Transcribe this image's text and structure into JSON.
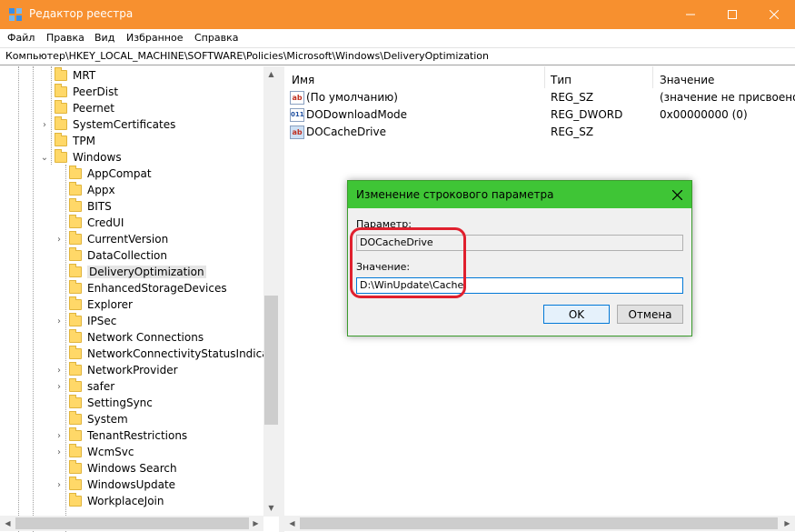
{
  "window": {
    "title": "Редактор реестра",
    "accent": "#f7902f"
  },
  "menu": [
    "Файл",
    "Правка",
    "Вид",
    "Избранное",
    "Справка"
  ],
  "address": "Компьютер\\HKEY_LOCAL_MACHINE\\SOFTWARE\\Policies\\Microsoft\\Windows\\DeliveryOptimization",
  "tree": {
    "level1": [
      {
        "label": "MRT",
        "expand": ""
      },
      {
        "label": "PeerDist",
        "expand": ""
      },
      {
        "label": "Peernet",
        "expand": ""
      },
      {
        "label": "SystemCertificates",
        "expand": "collapsed"
      },
      {
        "label": "TPM",
        "expand": ""
      },
      {
        "label": "Windows",
        "expand": "expanded"
      }
    ],
    "level2": [
      {
        "label": "AppCompat",
        "expand": ""
      },
      {
        "label": "Appx",
        "expand": ""
      },
      {
        "label": "BITS",
        "expand": ""
      },
      {
        "label": "CredUI",
        "expand": ""
      },
      {
        "label": "CurrentVersion",
        "expand": "collapsed"
      },
      {
        "label": "DataCollection",
        "expand": ""
      },
      {
        "label": "DeliveryOptimization",
        "expand": "",
        "selected": true
      },
      {
        "label": "EnhancedStorageDevices",
        "expand": ""
      },
      {
        "label": "Explorer",
        "expand": ""
      },
      {
        "label": "IPSec",
        "expand": "collapsed"
      },
      {
        "label": "Network Connections",
        "expand": ""
      },
      {
        "label": "NetworkConnectivityStatusIndicator",
        "expand": ""
      },
      {
        "label": "NetworkProvider",
        "expand": "collapsed"
      },
      {
        "label": "safer",
        "expand": "collapsed"
      },
      {
        "label": "SettingSync",
        "expand": ""
      },
      {
        "label": "System",
        "expand": ""
      },
      {
        "label": "TenantRestrictions",
        "expand": "collapsed"
      },
      {
        "label": "WcmSvc",
        "expand": "collapsed"
      },
      {
        "label": "Windows Search",
        "expand": ""
      },
      {
        "label": "WindowsUpdate",
        "expand": "collapsed"
      },
      {
        "label": "WorkplaceJoin",
        "expand": ""
      }
    ]
  },
  "list": {
    "columns": [
      "Имя",
      "Тип",
      "Значение"
    ],
    "rows": [
      {
        "icon": "ab",
        "name": "(По умолчанию)",
        "type": "REG_SZ",
        "value": "(значение не присвоено)"
      },
      {
        "icon": "011",
        "name": "DODownloadMode",
        "type": "REG_DWORD",
        "value": "0x00000000 (0)"
      },
      {
        "icon": "ab",
        "name": "DOCacheDrive",
        "type": "REG_SZ",
        "value": ""
      }
    ]
  },
  "dialog": {
    "title": "Изменение строкового параметра",
    "title_color": "#3fc536",
    "param_label": "Параметр:",
    "param_value": "DOCacheDrive",
    "value_label": "Значение:",
    "value_value": "D:\\WinUpdate\\Cache",
    "ok_label": "OK",
    "cancel_label": "Отмена",
    "highlight_color": "#e0202e"
  }
}
